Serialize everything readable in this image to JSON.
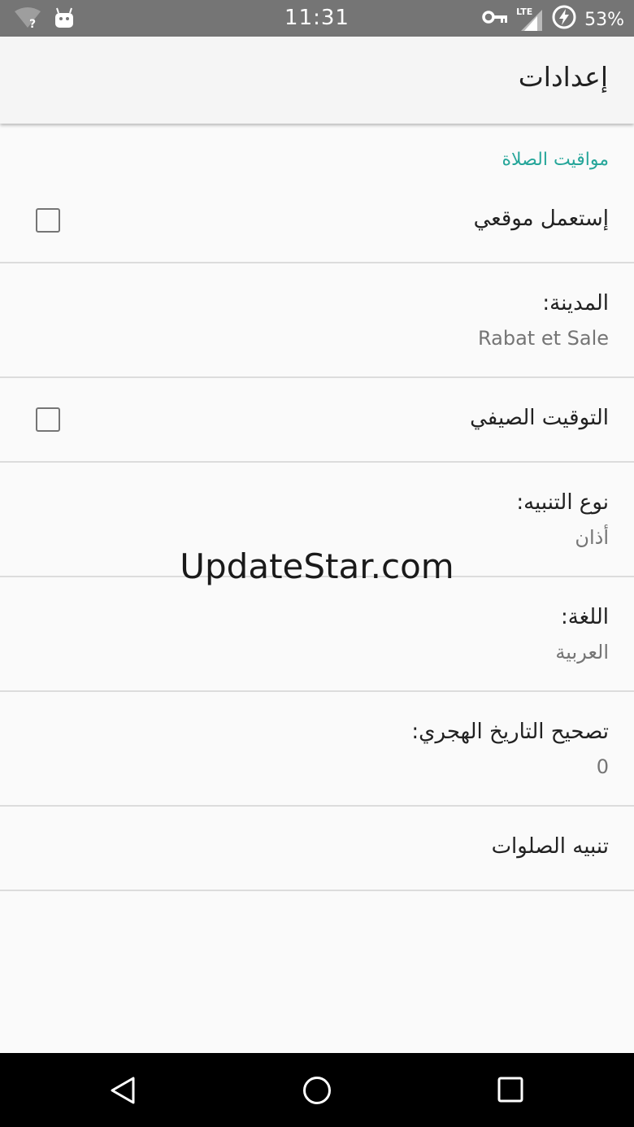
{
  "status_bar": {
    "time": "11:31",
    "battery": "53%",
    "network": "LTE",
    "icons": [
      "wifi-unknown-icon",
      "android-icon",
      "vpn-key-icon",
      "signal-icon",
      "battery-charging-icon"
    ]
  },
  "toolbar": {
    "title": "إعدادات"
  },
  "settings": {
    "category_title": "مواقيت الصلاة",
    "use_location": {
      "title": "إستعمل موقعي",
      "checked": false
    },
    "city": {
      "title": "المدينة:",
      "summary": "Rabat et Sale"
    },
    "daylight_saving": {
      "title": "التوقيت الصيفي",
      "checked": false
    },
    "alert_type": {
      "title": "نوع التنبيه:",
      "summary": "أذان"
    },
    "language": {
      "title": "اللغة:",
      "summary": "العربية"
    },
    "hijri_correction": {
      "title": "تصحيح التاريخ الهجري:",
      "summary": "0"
    },
    "prayer_alerts": {
      "title": "تنبيه الصلوات"
    }
  },
  "watermark": "UpdateStar.com",
  "colors": {
    "status_bar": "#757575",
    "toolbar": "#f5f5f5",
    "accent": "#26a69a",
    "nav_bar": "#000000"
  }
}
